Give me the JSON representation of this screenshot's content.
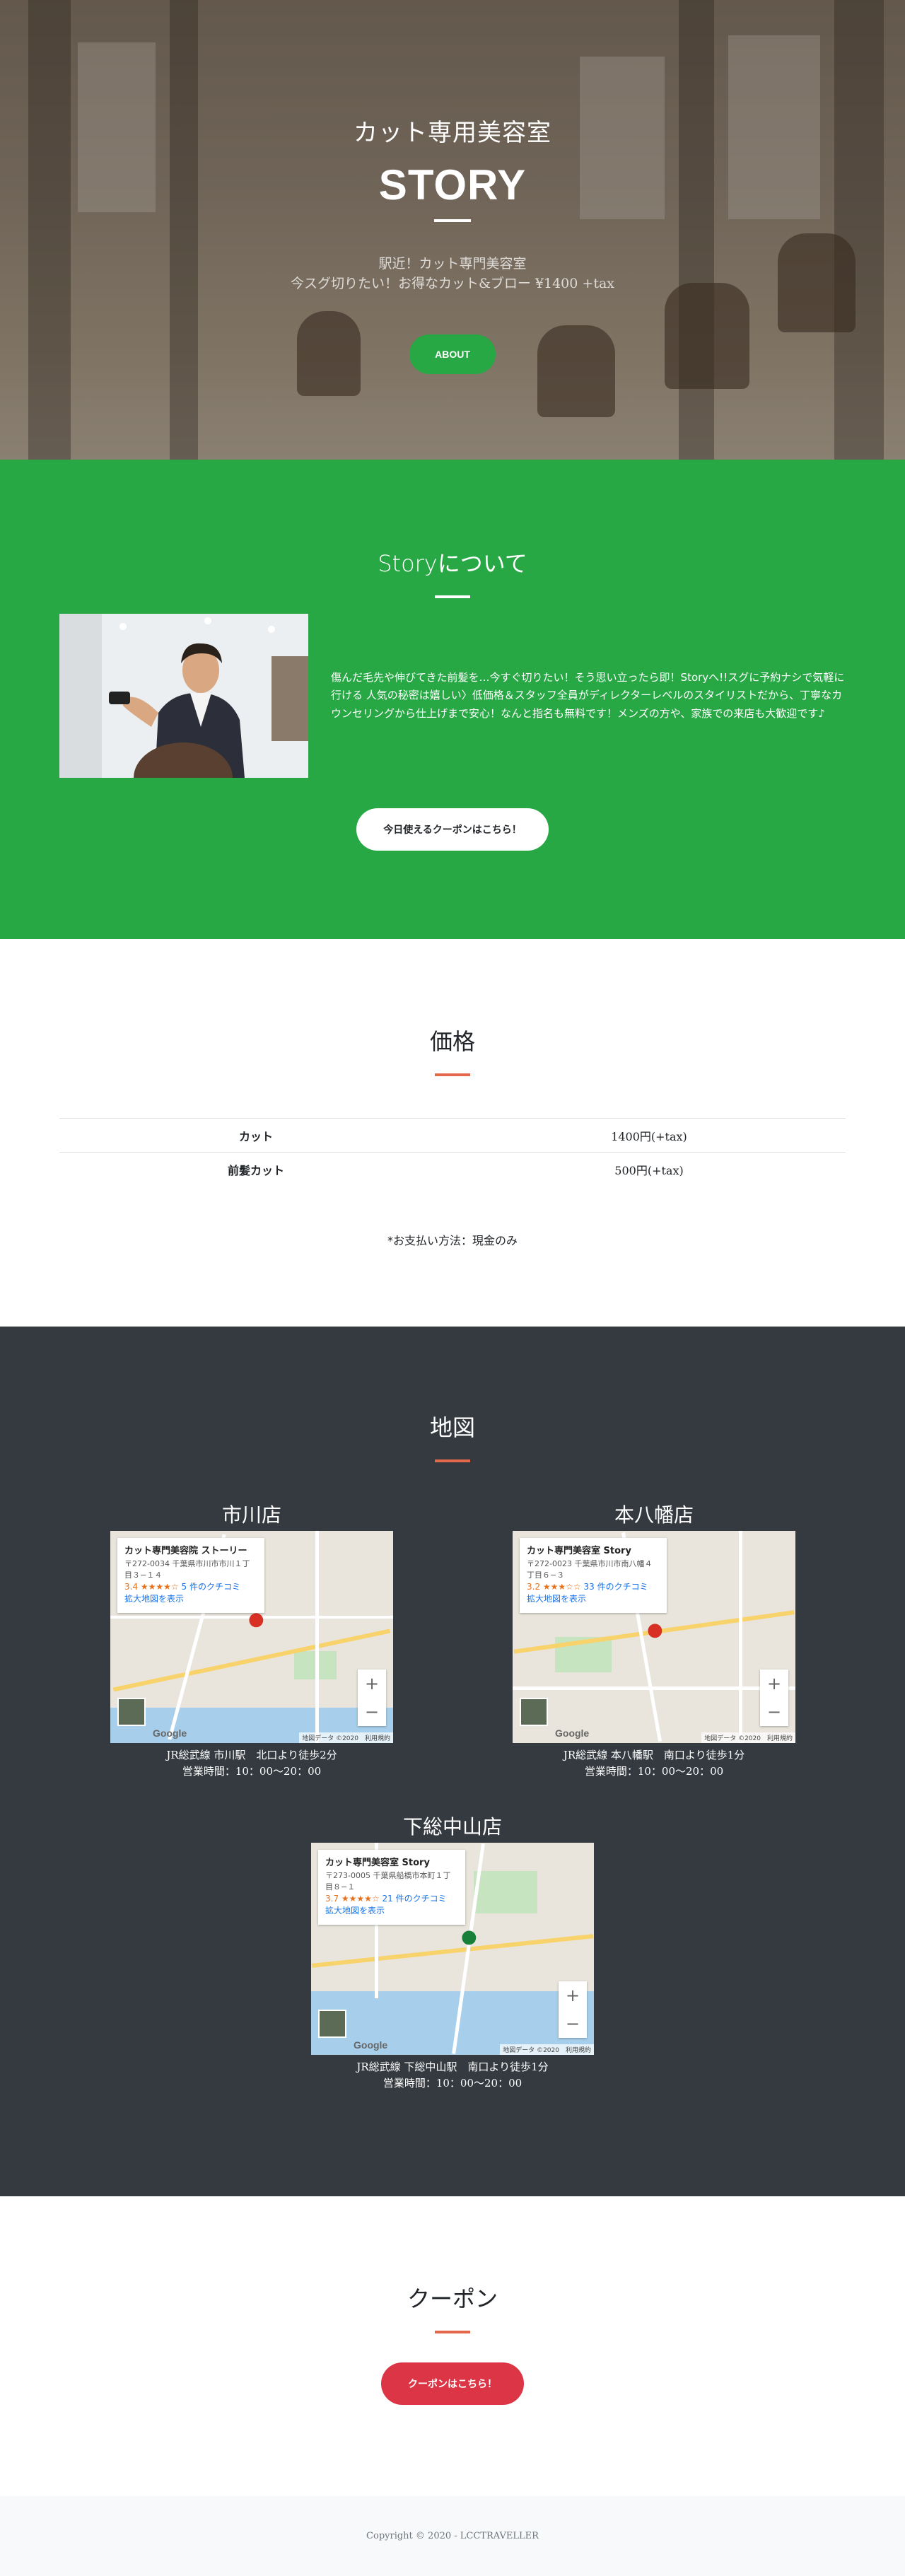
{
  "hero": {
    "subtitle": "カット専用美容室",
    "title": "STORY",
    "desc_line1": "駅近！カット専門美容室",
    "desc_line2": "今スグ切りたい！お得なカット&ブロー ¥1400 +tax",
    "about_button": "ABOUT"
  },
  "about": {
    "title": "Storyについて",
    "text": "傷んだ毛先や伸びてきた前髪を…今すぐ切りたい！そう思い立ったら即！Storyへ!!スグに予約ナシで気軽に行ける 人気の秘密は嬉しい〉低価格＆スタッフ全員がディレクターレベルのスタイリストだから、丁寧なカウンセリングから仕上げまで安心！なんと指名も無料です！メンズの方や、家族での来店も大歓迎です♪",
    "coupon_button": "今日使えるクーポンはこちら！"
  },
  "price": {
    "title": "価格",
    "rows": [
      {
        "item": "カット",
        "value": "1400円(+tax)"
      },
      {
        "item": "前髪カット",
        "value": "500円(+tax)"
      }
    ],
    "note": "*お支払い方法：現金のみ"
  },
  "map": {
    "title": "地図",
    "stores": [
      {
        "name": "市川店",
        "card_name": "カット専門美容院 ストーリー",
        "card_addr": "〒272-0034 千葉県市川市市川１丁目３−１４",
        "card_rating": "3.4 ★★★★☆",
        "card_reviews": "5 件のクチコミ",
        "card_link": "拡大地図を表示",
        "access": "JR総武線 市川駅　北口より徒歩2分",
        "hours": "営業時間：10：00〜20：00"
      },
      {
        "name": "本八幡店",
        "card_name": "カット専門美容室 Story",
        "card_addr": "〒272-0023 千葉県市川市南八幡４丁目６−３",
        "card_rating": "3.2 ★★★☆☆",
        "card_reviews": "33 件のクチコミ",
        "card_link": "拡大地図を表示",
        "access": "JR総武線 本八幡駅　南口より徒歩1分",
        "hours": "営業時間：10：00〜20：00"
      },
      {
        "name": "下総中山店",
        "card_name": "カット専門美容室 Story",
        "card_addr": "〒273-0005 千葉県船橋市本町１丁目８−１",
        "card_rating": "3.7 ★★★★☆",
        "card_reviews": "21 件のクチコミ",
        "card_link": "拡大地図を表示",
        "access": "JR総武線 下総中山駅　南口より徒歩1分",
        "hours": "営業時間：10：00〜20：00"
      }
    ],
    "map_attribution": "地図データ ©2020　利用規約",
    "google_label": "Google"
  },
  "coupon": {
    "title": "クーポン",
    "button": "クーポンはこちら！"
  },
  "footer": {
    "copyright": "Copyright © 2020 - LCCTRAVELLER"
  },
  "colors": {
    "green": "#28a745",
    "dark": "#343a40",
    "accent": "#e4684b",
    "red": "#dc3545"
  }
}
